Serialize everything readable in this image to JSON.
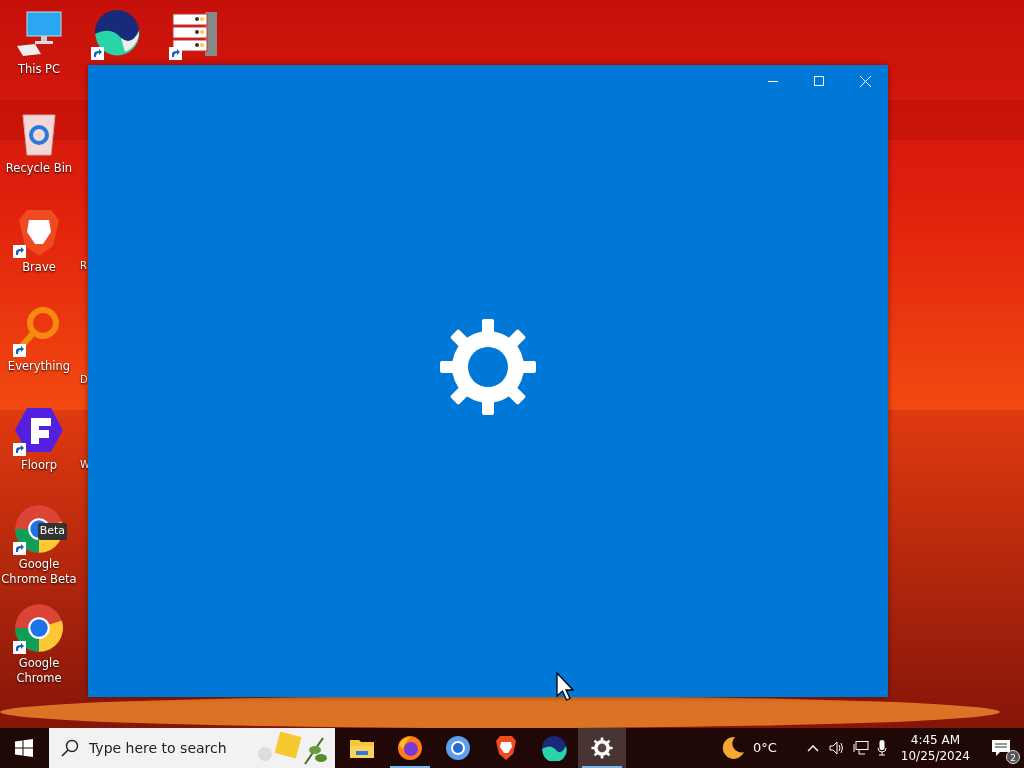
{
  "desktop_icons": [
    {
      "label": "This PC",
      "kind": "pc",
      "shortcut": false
    },
    {
      "kind": "whale",
      "shortcut": true
    },
    {
      "kind": "server",
      "shortcut": true
    },
    {
      "label": "Recycle Bin",
      "kind": "recycle",
      "shortcut": false
    },
    {
      "label": "Brave",
      "kind": "brave",
      "shortcut": true
    },
    {
      "label": "Everything",
      "kind": "everything",
      "shortcut": true
    },
    {
      "label": "Floorp",
      "kind": "floorp",
      "shortcut": true
    },
    {
      "label": "Google Chrome Beta",
      "kind": "chromebeta",
      "badge": "Beta",
      "shortcut": true
    },
    {
      "label": "Google Chrome",
      "kind": "chrome",
      "shortcut": true
    }
  ],
  "hidden_labels": [
    "R",
    "D",
    "W"
  ],
  "taskbar": {
    "search": {
      "placeholder": "Type here to search"
    },
    "apps": [
      {
        "kind": "explorer",
        "running": false,
        "selected": false
      },
      {
        "kind": "firefox",
        "running": true,
        "selected": false
      },
      {
        "kind": "chromium",
        "running": false,
        "selected": false
      },
      {
        "kind": "brave",
        "running": false,
        "selected": false
      },
      {
        "kind": "whale",
        "running": false,
        "selected": false
      },
      {
        "kind": "settings",
        "running": true,
        "selected": true
      }
    ],
    "weather": "0°C",
    "time": "4:45 AM",
    "date": "10/25/2024",
    "notifications": "2"
  }
}
